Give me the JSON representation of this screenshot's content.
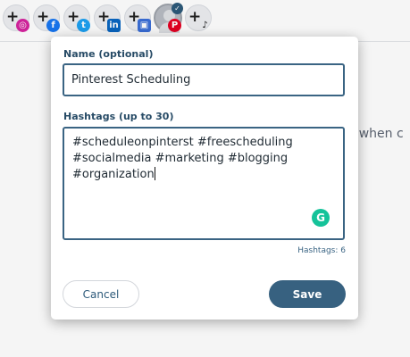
{
  "background": {
    "partial_text": "rt when c"
  },
  "accounts": [
    {
      "platform": "instagram",
      "icon": "instagram-icon",
      "glyph": "◎",
      "color": "#d6249f"
    },
    {
      "platform": "facebook",
      "icon": "facebook-icon",
      "glyph": "f",
      "color": "#1877f2"
    },
    {
      "platform": "twitter",
      "icon": "twitter-icon",
      "glyph": "t",
      "color": "#1da1f2"
    },
    {
      "platform": "linkedin",
      "icon": "linkedin-icon",
      "glyph": "in",
      "color": "#0a66c2"
    },
    {
      "platform": "google-business",
      "icon": "google-business-icon",
      "glyph": "▣",
      "color": "#3b6fd8"
    },
    {
      "platform": "pinterest",
      "icon": "pinterest-icon",
      "glyph": "P",
      "color": "#e60023",
      "selected": true
    },
    {
      "platform": "tiktok",
      "icon": "tiktok-icon",
      "glyph": "♪",
      "color": "#111111"
    }
  ],
  "modal": {
    "name_label": "Name (optional)",
    "name_value": "Pinterest Scheduling",
    "hashtags_label": "Hashtags (up to 30)",
    "hashtags_value": "#scheduleonpinterst #freescheduling\n#socialmedia #marketing #blogging\n#organization",
    "hashtag_count": "Hashtags: 6",
    "cancel_label": "Cancel",
    "save_label": "Save",
    "grammarly_glyph": "G"
  },
  "colors": {
    "accent": "#376180",
    "label": "#274b66",
    "grammarly": "#15c39a"
  }
}
